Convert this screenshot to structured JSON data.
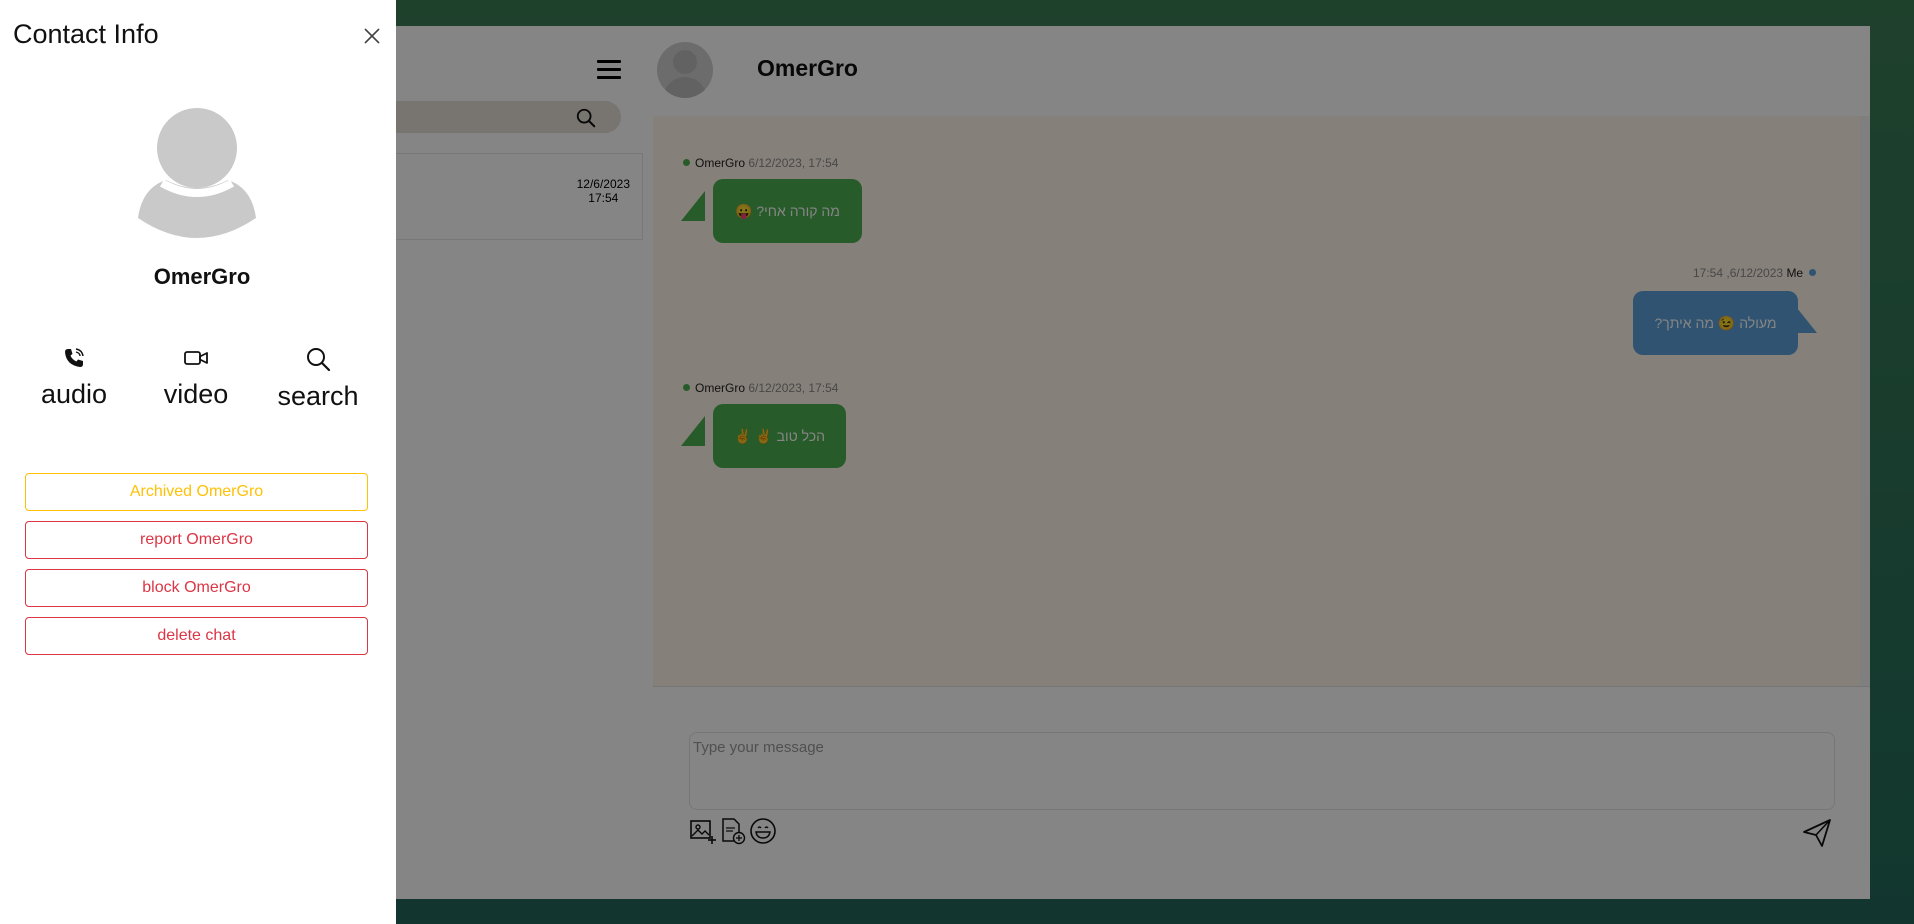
{
  "chat_list": {
    "chats": [
      {
        "date": "12/6/2023",
        "time": "17:54"
      }
    ]
  },
  "chat": {
    "contact_name": "OmerGro",
    "messages": [
      {
        "sender": "OmerGro",
        "timestamp": "6/12/2023, 17:54",
        "text": "מה קורה אחי? 😛",
        "direction": "in"
      },
      {
        "sender": "Me",
        "timestamp": "17:54 ,6/12/2023",
        "text": "מעולה 😉 מה איתך?",
        "direction": "out"
      },
      {
        "sender": "OmerGro",
        "timestamp": "6/12/2023, 17:54",
        "text": "הכל טוב ✌️ ✌",
        "direction": "in"
      }
    ],
    "composer": {
      "placeholder": "Type your message"
    }
  },
  "contact_info": {
    "title": "Contact Info",
    "name": "OmerGro",
    "actions": [
      {
        "label": "audio",
        "icon": "phone-icon"
      },
      {
        "label": "video",
        "icon": "video-camera-icon"
      },
      {
        "label": "search",
        "icon": "search-icon"
      }
    ],
    "buttons": [
      {
        "label": "Archived OmerGro",
        "color": "#ffc107"
      },
      {
        "label": "report OmerGro",
        "color": "#dc3545"
      },
      {
        "label": "block OmerGro",
        "color": "#dc3545"
      },
      {
        "label": "delete chat",
        "color": "#dc3545"
      }
    ]
  },
  "colors": {
    "incoming_bubble": "#4caf50",
    "outgoing_bubble": "#5aa0d8",
    "warning": "#ffc107",
    "danger": "#dc3545",
    "chat_background": "#fff5e9"
  }
}
